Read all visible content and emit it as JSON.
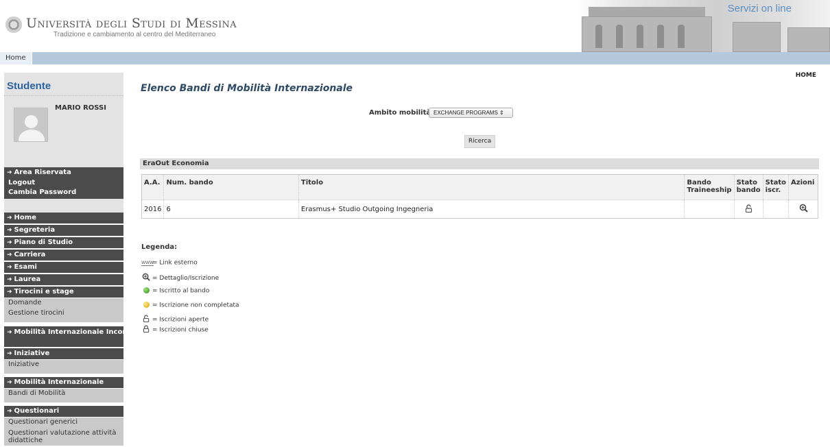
{
  "header": {
    "university": "Università degli Studi di Messina",
    "tagline": "Tradizione e cambiamento al centro del Mediterraneo",
    "services": "Servizi on line"
  },
  "navbar": {
    "home": "Home"
  },
  "sidebar": {
    "title": "Studente",
    "student_name": "MARIO ROSSI",
    "area_riservata": "Area Riservata",
    "logout": "Logout",
    "cambia_password": "Cambia Password",
    "menu": {
      "home": "Home",
      "segreteria": "Segreteria",
      "piano_studio": "Piano di Studio",
      "carriera": "Carriera",
      "esami": "Esami",
      "laurea": "Laurea",
      "tirocini": "Tirocini e stage",
      "domande": "Domande",
      "gestione_tirocini": "Gestione tirocini",
      "mobilita_incoming": "Mobilità Internazionale Incoming",
      "iniziative_h": "Iniziative",
      "iniziative": "Iniziative",
      "mobilita_int": "Mobilità Internazionale",
      "bandi_mobilita": "Bandi di Mobilità",
      "questionari": "Questionari",
      "questionari_generici": "Questionari generici",
      "questionari_valutazione": "Questionari valutazione attività didattiche"
    }
  },
  "main": {
    "home_link": "HOME",
    "title": "Elenco Bandi di Mobilità Internazionale",
    "ambito_label": "Ambito mobilità:",
    "ambito_value": "EXCHANGE PROGRAMS",
    "ricerca": "Ricerca",
    "section": "EraOut Economia",
    "table": {
      "headers": [
        "A.A.",
        "Num. bando",
        "Titolo",
        "Bando Traineeship",
        "Stato bando",
        "Stato iscr.",
        "Azioni"
      ],
      "rows": [
        {
          "aa": "2016",
          "num": "6",
          "titolo": "Erasmus+ Studio Outgoing Ingegneria",
          "traineeship": "",
          "stato_iscr": ""
        }
      ]
    },
    "legend": {
      "title": "Legenda:",
      "link_esterno": "= Link esterno",
      "dettaglio": "= Dettaglio/Iscrizione",
      "iscritto": "= Iscritto al bando",
      "non_completata": "= Iscrizione non completata",
      "aperte": "= Iscrizioni aperte",
      "chiuse": "= Iscrizioni chiuse"
    }
  }
}
